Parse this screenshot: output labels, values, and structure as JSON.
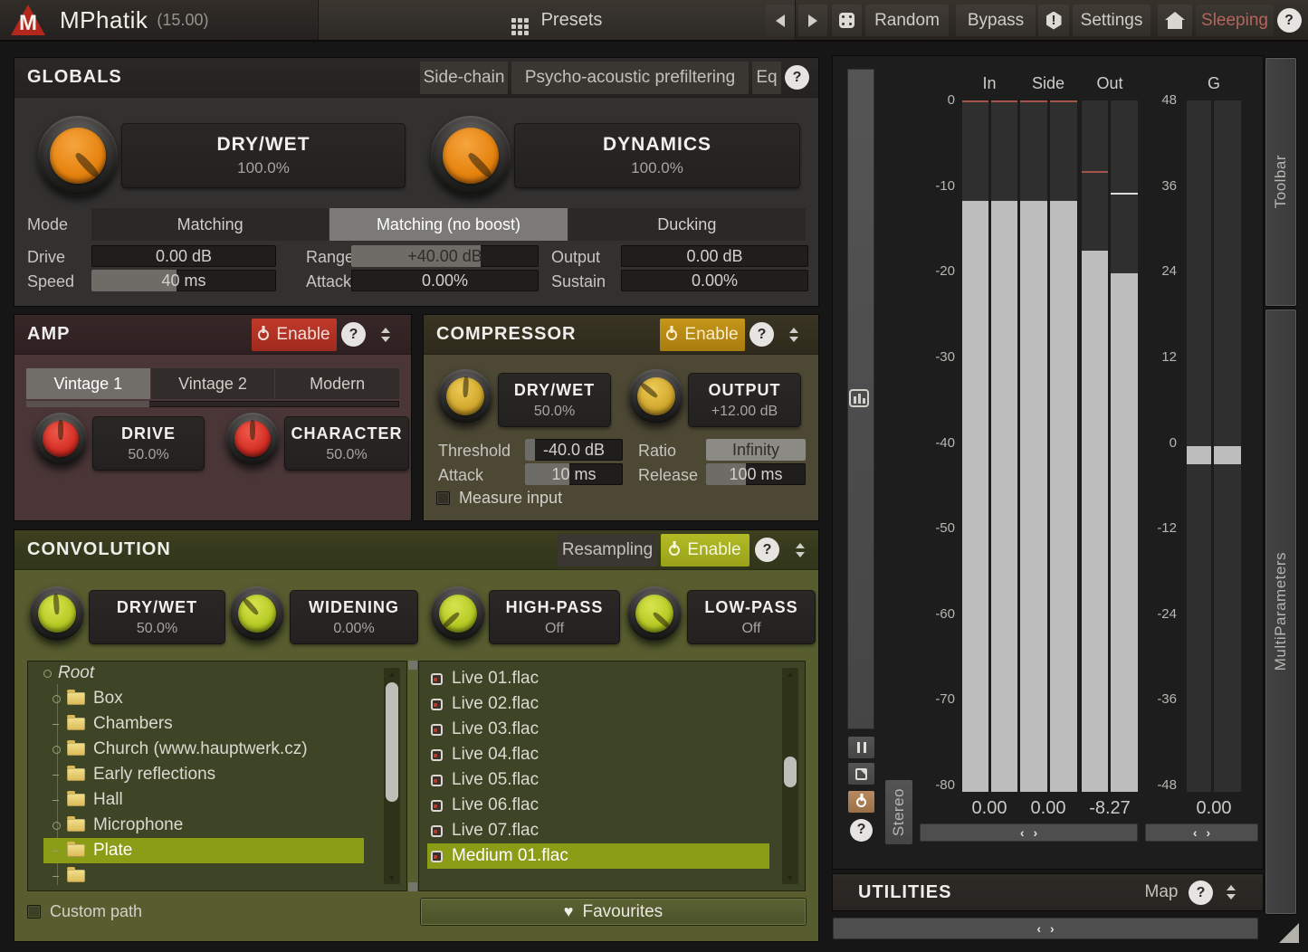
{
  "common": {
    "help_label": "?"
  },
  "titlebar": {
    "logo_letter": "M",
    "title": "MPhatik",
    "version": "(15.00)",
    "presets_label": "Presets",
    "random_label": "Random",
    "bypass_label": "Bypass",
    "settings_label": "Settings",
    "sleeping_label": "Sleeping",
    "accent_red": "#b3271c"
  },
  "globals": {
    "title": "GLOBALS",
    "header_buttons": [
      "Side-chain",
      "Psycho-acoustic prefiltering",
      "Eq"
    ],
    "knobs": [
      {
        "label": "DRY/WET",
        "value": "100.0%"
      },
      {
        "label": "DYNAMICS",
        "value": "100.0%"
      }
    ],
    "mode": {
      "label": "Mode",
      "options": [
        "Matching",
        "Matching (no boost)",
        "Ducking"
      ],
      "selected": "Matching (no boost)"
    },
    "params": [
      {
        "label": "Drive",
        "value": "0.00 dB",
        "fill_pct": 0
      },
      {
        "label": "Range",
        "value": "+40.00 dB",
        "fill_pct": 69
      },
      {
        "label": "Output",
        "value": "0.00 dB",
        "fill_pct": 0
      },
      {
        "label": "Speed",
        "value": "40 ms",
        "fill_pct": 46
      },
      {
        "label": "Attack",
        "value": "0.00%",
        "fill_pct": 0
      },
      {
        "label": "Sustain",
        "value": "0.00%",
        "fill_pct": 0
      }
    ]
  },
  "amp": {
    "title": "AMP",
    "enable_label": "Enable",
    "tabs": [
      "Vintage 1",
      "Vintage 2",
      "Modern"
    ],
    "selected_tab": "Vintage 1",
    "slider_fill_pct": 33,
    "knobs": [
      {
        "label": "DRIVE",
        "value": "50.0%"
      },
      {
        "label": "CHARACTER",
        "value": "50.0%"
      }
    ]
  },
  "compressor": {
    "title": "COMPRESSOR",
    "enable_label": "Enable",
    "knobs": [
      {
        "label": "DRY/WET",
        "value": "50.0%"
      },
      {
        "label": "OUTPUT",
        "value": "+12.00 dB"
      }
    ],
    "params": [
      {
        "label": "Threshold",
        "value": "-40.0 dB",
        "fill_pct": 10
      },
      {
        "label": "Ratio",
        "value": "Infinity",
        "fill_pct": 100
      },
      {
        "label": "Attack",
        "value": "10 ms",
        "fill_pct": 45
      },
      {
        "label": "Release",
        "value": "100 ms",
        "fill_pct": 40
      }
    ],
    "measure_input_label": "Measure input"
  },
  "convolution": {
    "title": "CONVOLUTION",
    "resampling_label": "Resampling",
    "enable_label": "Enable",
    "knobs": [
      {
        "label": "DRY/WET",
        "value": "50.0%"
      },
      {
        "label": "WIDENING",
        "value": "0.00%"
      },
      {
        "label": "HIGH-PASS",
        "value": "Off"
      },
      {
        "label": "LOW-PASS",
        "value": "Off"
      }
    ],
    "tree": {
      "root_label": "Root",
      "items": [
        {
          "label": "Box",
          "node": "circle"
        },
        {
          "label": "Chambers",
          "node": "dash"
        },
        {
          "label": "Church (www.hauptwerk.cz)",
          "node": "circle"
        },
        {
          "label": "Early reflections",
          "node": "dash"
        },
        {
          "label": "Hall",
          "node": "dash"
        },
        {
          "label": "Microphone",
          "node": "circle"
        },
        {
          "label": "Plate",
          "node": "dash",
          "selected": true
        },
        {
          "label": "",
          "node": "dash"
        }
      ]
    },
    "files": {
      "items": [
        {
          "label": "Live 01.flac"
        },
        {
          "label": "Live 02.flac"
        },
        {
          "label": "Live 03.flac"
        },
        {
          "label": "Live 04.flac"
        },
        {
          "label": "Live 05.flac"
        },
        {
          "label": "Live 06.flac"
        },
        {
          "label": "Live 07.flac"
        },
        {
          "label": "Medium 01.flac",
          "selected": true
        }
      ]
    },
    "custom_path_label": "Custom path",
    "favourites_label": "Favourites",
    "selection_color": "#8b9c17"
  },
  "meters": {
    "columns": [
      "In",
      "Side",
      "Out",
      "G"
    ],
    "scale_left": [
      "0",
      "-10",
      "-20",
      "-30",
      "-40",
      "-50",
      "-60",
      "-70",
      "-80"
    ],
    "scale_right": [
      "48",
      "36",
      "24",
      "12",
      "0",
      "-12",
      "-24",
      "-36",
      "-48"
    ],
    "readouts": {
      "in": "0.00",
      "side": "0.00",
      "out": "-8.27",
      "g": "0.00"
    },
    "bars": [
      {
        "fill_pct": 85.5,
        "peak_pct": 0,
        "peak_color": "#a5544c"
      },
      {
        "fill_pct": 85.5,
        "peak_pct": 0,
        "peak_color": "#a5544c"
      },
      {
        "fill_pct": 85.5,
        "peak_pct": 0,
        "peak_color": "#a5544c"
      },
      {
        "fill_pct": 85.5,
        "peak_pct": 0,
        "peak_color": "#a5544c"
      },
      {
        "fill_pct": 78.3,
        "peak_pct": 10.2,
        "peak_color": "#a5544c"
      },
      {
        "fill_pct": 75.0,
        "peak_pct": 13.3,
        "peak_color": "#dddddd"
      },
      {
        "segment": true,
        "offset_pct": 50,
        "height_pct": 2.6
      },
      {
        "segment": true,
        "offset_pct": 50,
        "height_pct": 2.6
      }
    ],
    "stereo_label": "Stereo"
  },
  "utilities": {
    "title": "UTILITIES",
    "map_label": "Map"
  },
  "side_panels": {
    "toolbar_label": "Toolbar",
    "multiparameters_label": "MultiParameters"
  }
}
